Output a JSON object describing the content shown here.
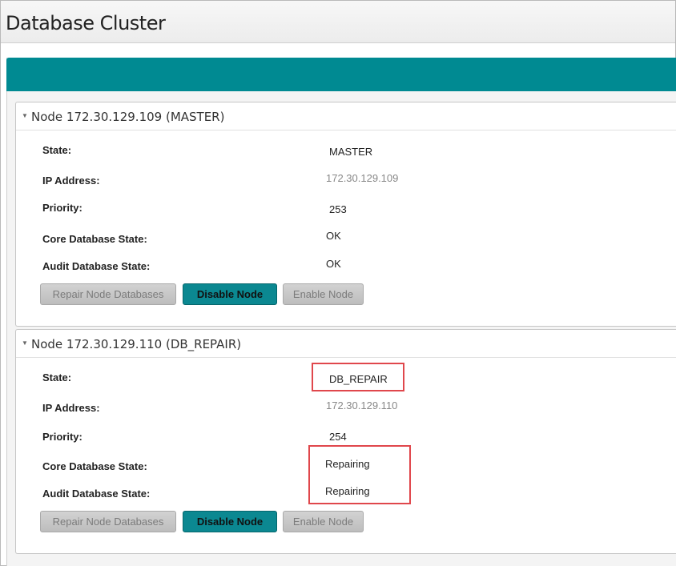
{
  "page": {
    "title": "Database Cluster"
  },
  "colors": {
    "accent": "#008a92",
    "button_primary": "#0b8891",
    "highlight": "#e0474c"
  },
  "nodes": [
    {
      "title": "Node 172.30.129.109 (MASTER)",
      "fields": [
        {
          "label": "State:",
          "value": "MASTER"
        },
        {
          "label": "IP Address:",
          "value": "172.30.129.109"
        },
        {
          "label": "Priority:",
          "value": "253"
        },
        {
          "label": "Core Database State:",
          "value": "OK"
        },
        {
          "label": "Audit Database State:",
          "value": "OK"
        }
      ],
      "buttons": [
        {
          "label": "Repair Node Databases",
          "enabled": false
        },
        {
          "label": "Disable Node",
          "enabled": true
        },
        {
          "label": "Enable Node",
          "enabled": false
        }
      ]
    },
    {
      "title": "Node 172.30.129.110 (DB_REPAIR)",
      "fields": [
        {
          "label": "State:",
          "value": "DB_REPAIR"
        },
        {
          "label": "IP Address:",
          "value": "172.30.129.110"
        },
        {
          "label": "Priority:",
          "value": "254"
        },
        {
          "label": "Core Database State:",
          "value": "Repairing"
        },
        {
          "label": "Audit Database State:",
          "value": "Repairing"
        }
      ],
      "buttons": [
        {
          "label": "Repair Node Databases",
          "enabled": false
        },
        {
          "label": "Disable Node",
          "enabled": true
        },
        {
          "label": "Enable Node",
          "enabled": false
        }
      ]
    }
  ]
}
